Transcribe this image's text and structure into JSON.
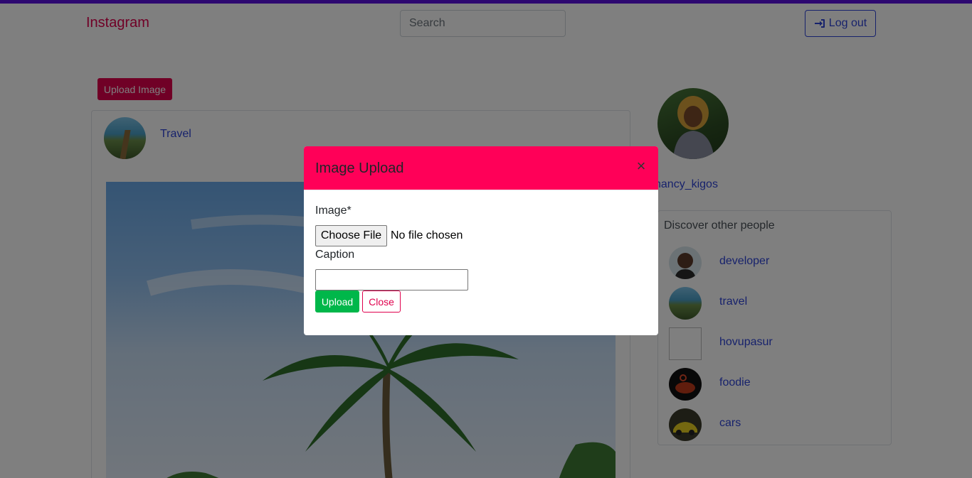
{
  "navbar": {
    "brand": "Instagram",
    "search_placeholder": "Search",
    "logout_label": "Log out"
  },
  "main": {
    "upload_button_label": "Upload Image",
    "post": {
      "username": "Travel"
    }
  },
  "profile": {
    "username": "nancy_kigos"
  },
  "discover": {
    "title": "Discover other people",
    "people": [
      {
        "name": "developer"
      },
      {
        "name": "travel"
      },
      {
        "name": "hovupasur"
      },
      {
        "name": "foodie"
      },
      {
        "name": "cars"
      }
    ]
  },
  "modal": {
    "title": "Image Upload",
    "close_icon": "×",
    "image_label": "Image*",
    "file_button_label": "Choose File",
    "file_status": "No file chosen",
    "caption_label": "Caption",
    "caption_value": "",
    "upload_label": "Upload",
    "close_label": "Close"
  },
  "colors": {
    "brand": "#e0004d",
    "modal_header": "#ff0058",
    "link": "#2f45d9",
    "success": "#00b74a",
    "topbar": "#5a10e0"
  }
}
